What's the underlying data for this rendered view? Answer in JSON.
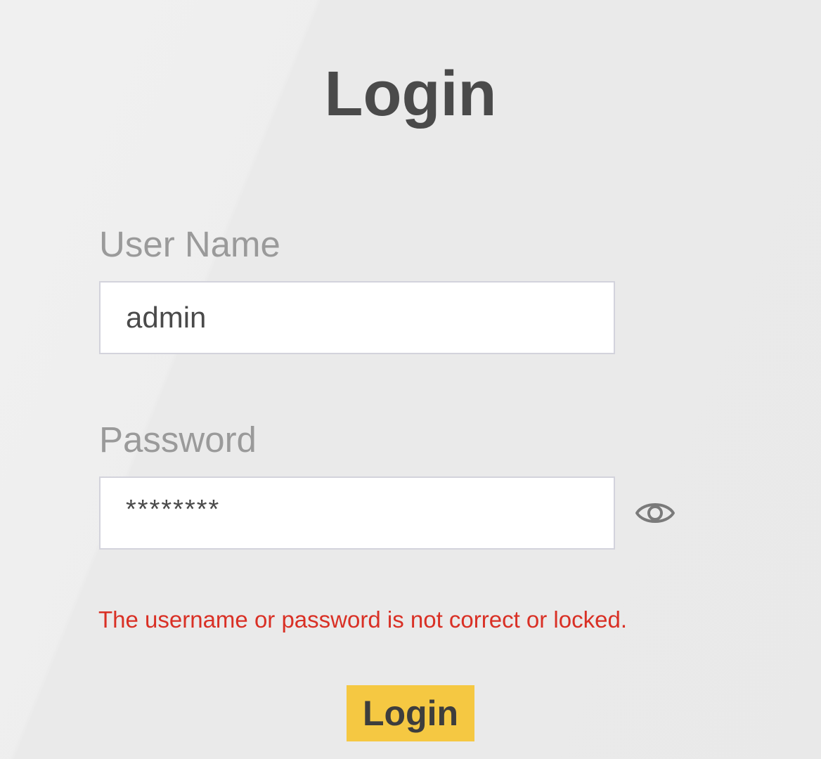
{
  "page": {
    "title": "Login"
  },
  "form": {
    "username_label": "User Name",
    "username_value": "admin",
    "password_label": "Password",
    "password_value": "********",
    "show_password_icon": "eye-icon",
    "error_message": "The username or password is not correct or locked.",
    "submit_label": "Login"
  },
  "colors": {
    "background": "#ebebeb",
    "title": "#4a4a4a",
    "label": "#9a9a9a",
    "input_border": "#d3d3dc",
    "error": "#d93025",
    "button": "#f5c842",
    "button_text": "#3d3d3d"
  }
}
